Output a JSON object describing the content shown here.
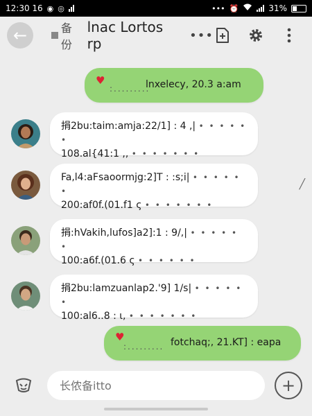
{
  "status_bar": {
    "time": "12:30 16",
    "battery_text": "31%"
  },
  "header": {
    "back_glyph": "←",
    "title_prefix": "备份",
    "title": "lnac Lortos rp",
    "more_glyph": "•••"
  },
  "messages": [
    {
      "direction": "out",
      "heart": "♥",
      "dots": ":.........",
      "text": "lnxelecy, 20.3 a:am"
    },
    {
      "direction": "in",
      "avatar": "avatar-woman-1",
      "line1": "捐2bu:taim:amja:22/1] : 4 ,|",
      "dots1": "• • • • • •",
      "line2": "108.al{41:1 ,,",
      "dots2": "• • • • • • •"
    },
    {
      "direction": "in",
      "avatar": "avatar-woman-2",
      "line1": "Fa,l4:aFsaoormjg:2]T : :s;i|",
      "dots1": "• • • • • •",
      "line2": "200:af0f.(01.f1 ς",
      "dots2": "• • • • • • •"
    },
    {
      "direction": "in",
      "avatar": "avatar-man-1",
      "line1": "捐:hVakih,lufos]a2]:1 : 9/,|",
      "dots1": "• • • • • •",
      "line2": "100:a6f.(01.6 ς",
      "dots2": "• • • • • •"
    },
    {
      "direction": "in",
      "avatar": "avatar-man-2",
      "line1": "捐2bu:lamzuanlap2.'9] 1/s|",
      "dots1": "• • • • • •",
      "line2": "100:al6..8 : ι,",
      "dots2": "• • • • • • •"
    },
    {
      "direction": "out",
      "heart": "♥",
      "dots": ":.........",
      "text": "fotchaq;, 21.KT] : eapa"
    }
  ],
  "composer": {
    "placeholder": "长侬备itto",
    "add_glyph": "+"
  },
  "colors": {
    "outgoing_bubble": "#95d475",
    "incoming_bubble": "#ffffff",
    "background": "#ededed"
  }
}
